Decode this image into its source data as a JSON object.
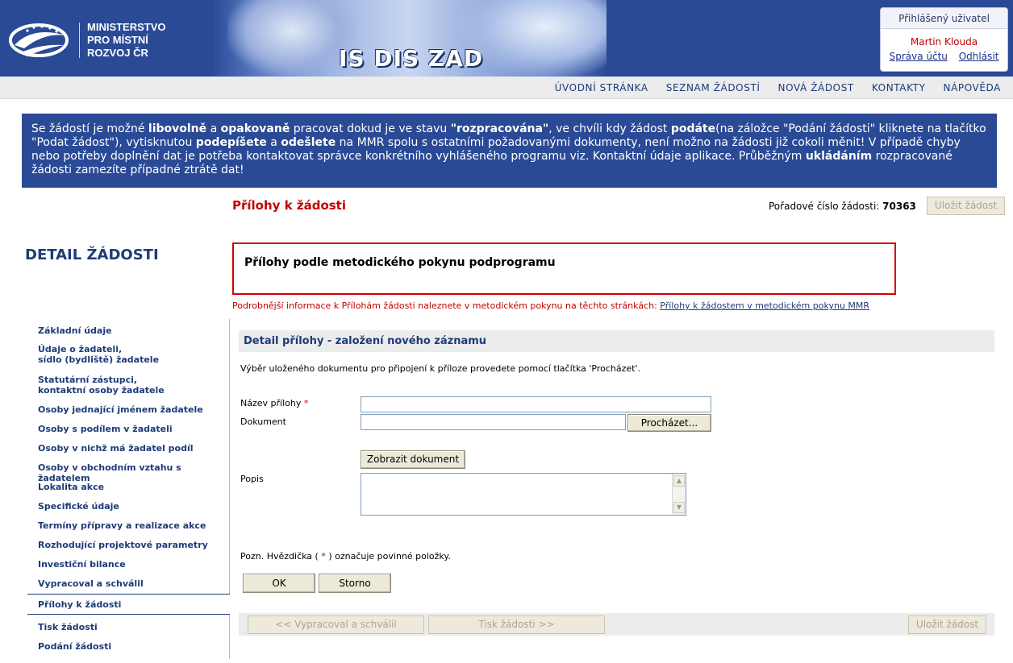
{
  "header": {
    "ministry_lines": [
      "MINISTERSTVO",
      "PRO MÍSTNÍ",
      "ROZVOJ ČR"
    ],
    "app_title": "IS DIS ZAD",
    "user_box_title": "Přihlášený uživatel",
    "user_name": "Martin Klouda",
    "account_link": "Správa účtu",
    "logout_link": "Odhlásit",
    "brand_color": "#2a4a96"
  },
  "topnav": {
    "items": [
      "ÚVODNÍ STRÁNKA",
      "SEZNAM ŽÁDOSTÍ",
      "NOVÁ ŽÁDOST",
      "KONTAKTY",
      "NÁPOVĚDA"
    ]
  },
  "info": {
    "p1": "Se žádostí je možné ",
    "b1": "libovolně",
    "p2": " a ",
    "b2": "opakovaně",
    "p3": " pracovat dokud je ve stavu ",
    "b3": "\"rozpracována\"",
    "p4": ", ve chvíli kdy žádost ",
    "b4": "podáte",
    "p5": "(na záložce \"Podání žádosti\" kliknete na tlačítko \"Podat žádost\"), vytisknutou ",
    "b5": "podepíšete",
    "p6": " a ",
    "b6": "odešlete",
    "p7": " na MMR spolu s ostatními požadovanými dokumenty, není možno na žádosti již cokoli měnit! V případě chyby nebo potřeby doplnění dat je potřeba kontaktovat správce konkrétního vyhlášeného programu viz. Kontaktní údaje aplikace. Průběžným ",
    "b7": "ukládáním",
    "p8": " rozpracované žádosti zamezíte případné ztrátě dat!"
  },
  "page": {
    "heading": "Přílohy k žádosti",
    "order_label": "Pořadové číslo žádosti:",
    "order_number": "70363",
    "save_label": "Uložit žádost"
  },
  "sidebar": {
    "title": "DETAIL ŽÁDOSTI",
    "items": [
      {
        "line1": "Základní údaje",
        "line2": ""
      },
      {
        "line1": "Údaje o žadateli,",
        "line2": "sídlo (bydliště) žadatele"
      },
      {
        "line1": "Statutární zástupci,",
        "line2": "kontaktní osoby žadatele"
      },
      {
        "line1": "Osoby jednající jménem žadatele",
        "line2": ""
      },
      {
        "line1": "Osoby s podílem v žadateli",
        "line2": ""
      },
      {
        "line1": "Osoby v nichž má žadatel podíl",
        "line2": ""
      },
      {
        "line1": "Osoby v obchodním vztahu s žadatelem",
        "line2": ""
      },
      {
        "line1": "Lokalita akce",
        "line2": ""
      },
      {
        "line1": "Specifické údaje",
        "line2": ""
      },
      {
        "line1": "Termíny přípravy a realizace akce",
        "line2": ""
      },
      {
        "line1": "Rozhodující projektové parametry",
        "line2": ""
      },
      {
        "line1": "Investiční bilance",
        "line2": ""
      },
      {
        "line1": "Vypracoval a schválil",
        "line2": ""
      },
      {
        "line1": "Přílohy k žádosti",
        "line2": ""
      },
      {
        "line1": "Tisk žádosti",
        "line2": ""
      },
      {
        "line1": "Podání žádosti",
        "line2": ""
      }
    ],
    "active_index": 13
  },
  "attachments_box": {
    "title": "Přílohy podle metodického pokynu podprogramu",
    "note": "Podrobnější informace k Přílohám žádosti naleznete v metodickém pokynu na těchto stránkách: ",
    "note_link": "Přílohy k žádostem v metodickém pokynu MMR"
  },
  "form": {
    "header": "Detail přílohy - založení nového záznamu",
    "hint": "Výběr uloženého dokumentu pro připojení k příloze provedete pomocí tlačítka 'Procházet'.",
    "name_label": "Název přílohy",
    "required_mark": "*",
    "name_value": "",
    "document_label": "Dokument",
    "document_value": "",
    "browse_label": "Procházet...",
    "show_document_label": "Zobrazit dokument",
    "description_label": "Popis",
    "description_value": "",
    "footnote_before": "Pozn. Hvězdička ( ",
    "footnote_mark": "*",
    "footnote_after": " ) označuje povinné položky.",
    "ok_label": "OK",
    "cancel_label": "Storno"
  },
  "bottom_bar": {
    "prev_label": "<<  Vypracoval a schválil",
    "next_label": "Tisk žádosti  >>",
    "save_label": "Uložit žádost"
  }
}
